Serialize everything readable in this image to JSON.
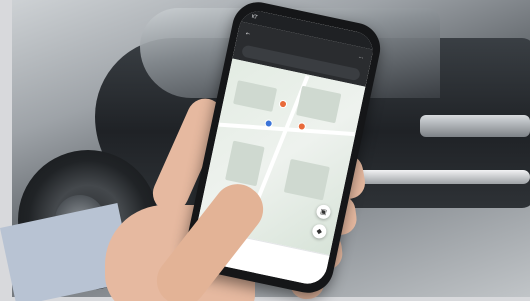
{
  "photo": {
    "subject": "",
    "elements": [
      "car",
      "hand",
      "phone",
      "map-app"
    ]
  },
  "phone_ui": {
    "status": {
      "left": "KT",
      "right": ""
    },
    "top_bar": {
      "search_placeholder": ""
    },
    "map": {
      "labels": [
        "",
        "",
        ""
      ]
    },
    "bottom_sheet": {
      "tabs": [
        "",
        "",
        ""
      ]
    },
    "icons": {
      "back": "back-arrow-icon",
      "menu": "menu-icon",
      "car": "car-icon",
      "navigate": "navigate-icon",
      "pin": "map-pin-icon"
    }
  }
}
